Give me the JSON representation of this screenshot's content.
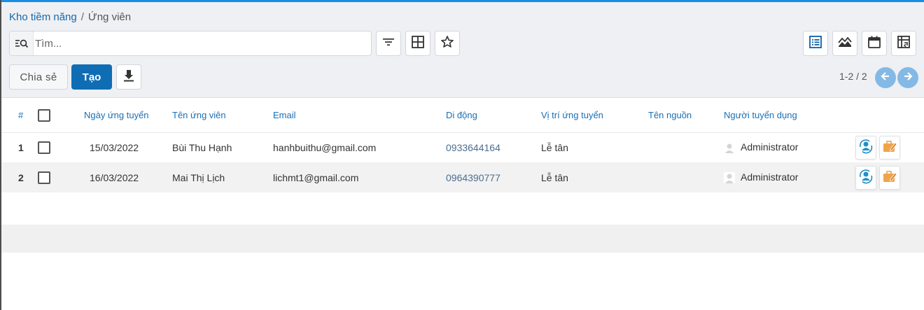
{
  "breadcrumb": {
    "parent": "Kho tiềm năng",
    "separator": "/",
    "current": "Ứng viên"
  },
  "search": {
    "placeholder": "Tìm..."
  },
  "search_icons": [
    "search-facet-icon",
    "filter-icon",
    "group-by-icon",
    "favorite-star-icon"
  ],
  "view_switcher": [
    "list-view-icon",
    "kanban-view-icon",
    "calendar-view-icon",
    "pivot-view-icon"
  ],
  "actions": {
    "share_label": "Chia sẻ",
    "create_label": "Tạo",
    "download_icon": "download-icon"
  },
  "pager": {
    "value": "1-2 / 2",
    "prev_icon": "arrow-left-icon",
    "next_icon": "arrow-right-icon"
  },
  "colors": {
    "accent": "#0f6db4",
    "header_text": "#1a6fb5",
    "pager": "#84b9e6",
    "panel_bg": "#eef0f4",
    "action_blue": "#1e90c8",
    "action_orange": "#f0a44a"
  },
  "table": {
    "columns": [
      "#",
      "Ngày ứng tuyển",
      "Tên ứng viên",
      "Email",
      "Di động",
      "Vị trí ứng tuyển",
      "Tên nguồn",
      "Người tuyển dụng"
    ],
    "rows": [
      {
        "index": "1",
        "date": "15/03/2022",
        "name": "Bùi Thu Hạnh",
        "email": "hanhbuithu@gmail.com",
        "phone": "0933644164",
        "position": "Lễ tân",
        "source": "",
        "recruiter": "Administrator"
      },
      {
        "index": "2",
        "date": "16/03/2022",
        "name": "Mai Thị Lịch",
        "email": "lichmt1@gmail.com",
        "phone": "0964390777",
        "position": "Lễ tân",
        "source": "",
        "recruiter": "Administrator"
      }
    ],
    "row_action_icons": [
      "refresh-user-icon",
      "briefcase-edit-icon"
    ]
  }
}
